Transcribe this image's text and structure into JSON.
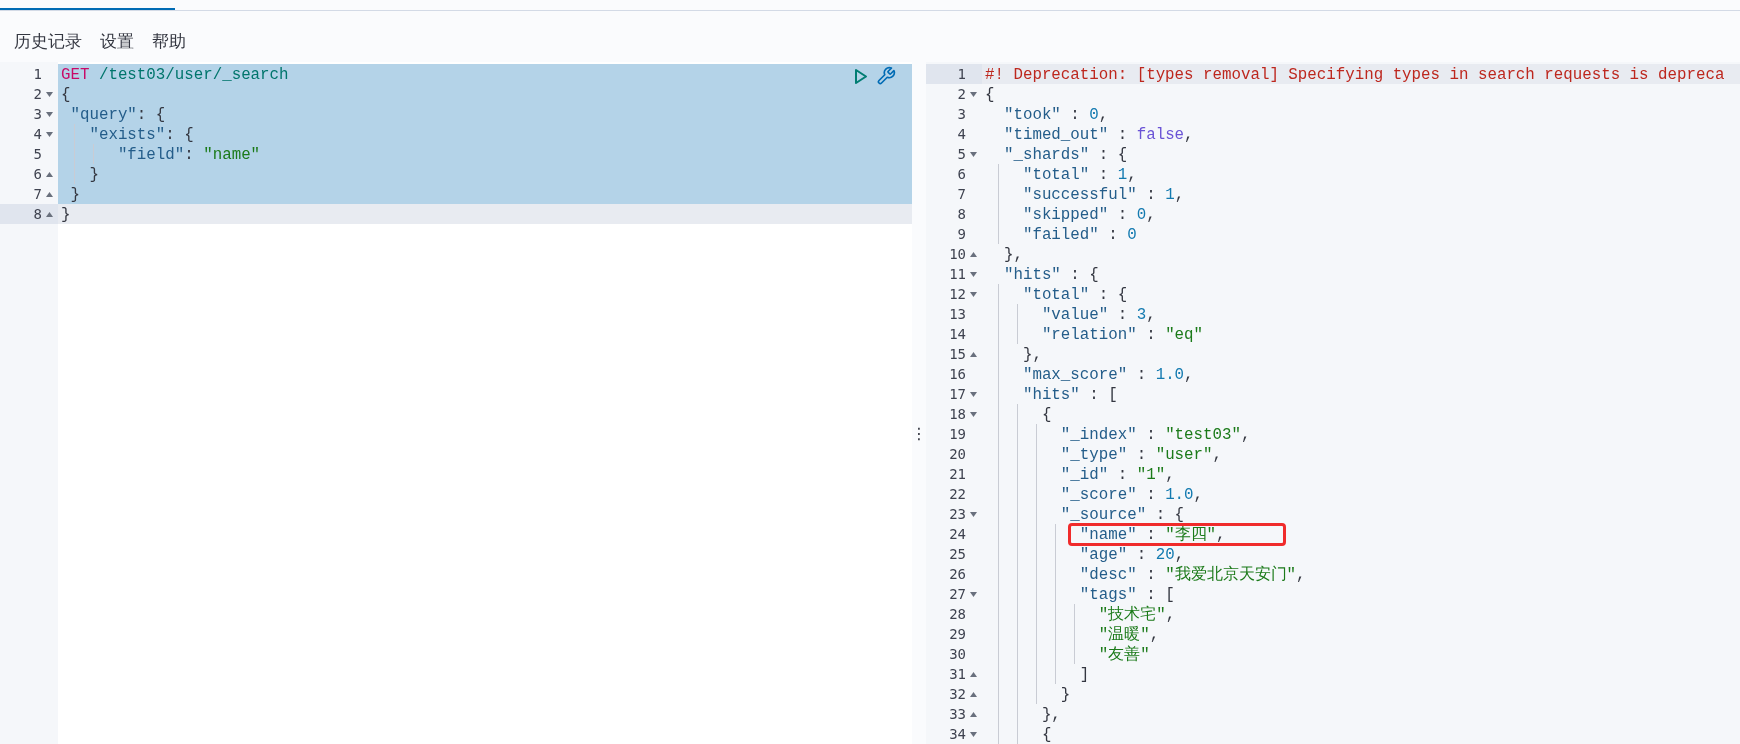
{
  "menu": [
    "历史记录",
    "设置",
    "帮助"
  ],
  "request_editor": {
    "lines": [
      {
        "n": "1",
        "kind": "plain",
        "selected": true,
        "active": false,
        "tokens": [
          {
            "kind": "method",
            "text": "GET"
          },
          {
            "kind": "url",
            "text": " /test03/user/_search"
          }
        ]
      },
      {
        "n": "2",
        "kind": "open",
        "selected": true,
        "active": false,
        "tokens": [
          {
            "kind": "punct",
            "text": "{"
          }
        ]
      },
      {
        "n": "3",
        "kind": "open",
        "selected": true,
        "active": false,
        "tokens": [
          {
            "kind": "key",
            "text": " \"query\""
          },
          {
            "kind": "punct",
            "text": ": {"
          }
        ]
      },
      {
        "n": "4",
        "kind": "open",
        "selected": true,
        "active": false,
        "tokens": [
          {
            "kind": "key",
            "text": "   \"exists\""
          },
          {
            "kind": "punct",
            "text": ": {"
          }
        ]
      },
      {
        "n": "5",
        "kind": "plain",
        "selected": true,
        "active": false,
        "tokens": [
          {
            "kind": "key",
            "text": "      \"field\""
          },
          {
            "kind": "punct",
            "text": ": "
          },
          {
            "kind": "string",
            "text": "\"name\""
          }
        ]
      },
      {
        "n": "6",
        "kind": "close",
        "selected": true,
        "active": false,
        "tokens": [
          {
            "kind": "punct",
            "text": "   }"
          }
        ]
      },
      {
        "n": "7",
        "kind": "close",
        "selected": true,
        "active": false,
        "tokens": [
          {
            "kind": "punct",
            "text": " }"
          }
        ]
      },
      {
        "n": "8",
        "kind": "close",
        "selected": false,
        "active": true,
        "tokens": [
          {
            "kind": "punct",
            "text": "}"
          }
        ]
      }
    ]
  },
  "response_editor": {
    "lines": [
      {
        "n": "1",
        "kind": "plain",
        "active": true,
        "boxed": false,
        "tokens": [
          {
            "kind": "comment",
            "text": "#! Deprecation: [types removal] Specifying types in search requests is depreca"
          }
        ]
      },
      {
        "n": "2",
        "kind": "open",
        "active": false,
        "boxed": false,
        "tokens": [
          {
            "kind": "punct",
            "text": "{"
          }
        ]
      },
      {
        "n": "3",
        "kind": "plain",
        "active": false,
        "boxed": false,
        "tokens": [
          {
            "kind": "key",
            "text": "  \"took\""
          },
          {
            "kind": "punct",
            "text": " : "
          },
          {
            "kind": "number",
            "text": "0"
          },
          {
            "kind": "punct",
            "text": ","
          }
        ]
      },
      {
        "n": "4",
        "kind": "plain",
        "active": false,
        "boxed": false,
        "tokens": [
          {
            "kind": "key",
            "text": "  \"timed_out\""
          },
          {
            "kind": "punct",
            "text": " : "
          },
          {
            "kind": "bool",
            "text": "false"
          },
          {
            "kind": "punct",
            "text": ","
          }
        ]
      },
      {
        "n": "5",
        "kind": "open",
        "active": false,
        "boxed": false,
        "tokens": [
          {
            "kind": "key",
            "text": "  \"_shards\""
          },
          {
            "kind": "punct",
            "text": " : {"
          }
        ]
      },
      {
        "n": "6",
        "kind": "plain",
        "active": false,
        "boxed": false,
        "tokens": [
          {
            "kind": "key",
            "text": "    \"total\""
          },
          {
            "kind": "punct",
            "text": " : "
          },
          {
            "kind": "number",
            "text": "1"
          },
          {
            "kind": "punct",
            "text": ","
          }
        ]
      },
      {
        "n": "7",
        "kind": "plain",
        "active": false,
        "boxed": false,
        "tokens": [
          {
            "kind": "key",
            "text": "    \"successful\""
          },
          {
            "kind": "punct",
            "text": " : "
          },
          {
            "kind": "number",
            "text": "1"
          },
          {
            "kind": "punct",
            "text": ","
          }
        ]
      },
      {
        "n": "8",
        "kind": "plain",
        "active": false,
        "boxed": false,
        "tokens": [
          {
            "kind": "key",
            "text": "    \"skipped\""
          },
          {
            "kind": "punct",
            "text": " : "
          },
          {
            "kind": "number",
            "text": "0"
          },
          {
            "kind": "punct",
            "text": ","
          }
        ]
      },
      {
        "n": "9",
        "kind": "plain",
        "active": false,
        "boxed": false,
        "tokens": [
          {
            "kind": "key",
            "text": "    \"failed\""
          },
          {
            "kind": "punct",
            "text": " : "
          },
          {
            "kind": "number",
            "text": "0"
          }
        ]
      },
      {
        "n": "10",
        "kind": "close",
        "active": false,
        "boxed": false,
        "tokens": [
          {
            "kind": "punct",
            "text": "  },"
          }
        ]
      },
      {
        "n": "11",
        "kind": "open",
        "active": false,
        "boxed": false,
        "tokens": [
          {
            "kind": "key",
            "text": "  \"hits\""
          },
          {
            "kind": "punct",
            "text": " : {"
          }
        ]
      },
      {
        "n": "12",
        "kind": "open",
        "active": false,
        "boxed": false,
        "tokens": [
          {
            "kind": "key",
            "text": "    \"total\""
          },
          {
            "kind": "punct",
            "text": " : {"
          }
        ]
      },
      {
        "n": "13",
        "kind": "plain",
        "active": false,
        "boxed": false,
        "tokens": [
          {
            "kind": "key",
            "text": "      \"value\""
          },
          {
            "kind": "punct",
            "text": " : "
          },
          {
            "kind": "number",
            "text": "3"
          },
          {
            "kind": "punct",
            "text": ","
          }
        ]
      },
      {
        "n": "14",
        "kind": "plain",
        "active": false,
        "boxed": false,
        "tokens": [
          {
            "kind": "key",
            "text": "      \"relation\""
          },
          {
            "kind": "punct",
            "text": " : "
          },
          {
            "kind": "string",
            "text": "\"eq\""
          }
        ]
      },
      {
        "n": "15",
        "kind": "close",
        "active": false,
        "boxed": false,
        "tokens": [
          {
            "kind": "punct",
            "text": "    },"
          }
        ]
      },
      {
        "n": "16",
        "kind": "plain",
        "active": false,
        "boxed": false,
        "tokens": [
          {
            "kind": "key",
            "text": "    \"max_score\""
          },
          {
            "kind": "punct",
            "text": " : "
          },
          {
            "kind": "number",
            "text": "1.0"
          },
          {
            "kind": "punct",
            "text": ","
          }
        ]
      },
      {
        "n": "17",
        "kind": "open",
        "active": false,
        "boxed": false,
        "tokens": [
          {
            "kind": "key",
            "text": "    \"hits\""
          },
          {
            "kind": "punct",
            "text": " : ["
          }
        ]
      },
      {
        "n": "18",
        "kind": "open",
        "active": false,
        "boxed": false,
        "tokens": [
          {
            "kind": "punct",
            "text": "      {"
          }
        ]
      },
      {
        "n": "19",
        "kind": "plain",
        "active": false,
        "boxed": false,
        "tokens": [
          {
            "kind": "key",
            "text": "        \"_index\""
          },
          {
            "kind": "punct",
            "text": " : "
          },
          {
            "kind": "string",
            "text": "\"test03\""
          },
          {
            "kind": "punct",
            "text": ","
          }
        ]
      },
      {
        "n": "20",
        "kind": "plain",
        "active": false,
        "boxed": false,
        "tokens": [
          {
            "kind": "key",
            "text": "        \"_type\""
          },
          {
            "kind": "punct",
            "text": " : "
          },
          {
            "kind": "string",
            "text": "\"user\""
          },
          {
            "kind": "punct",
            "text": ","
          }
        ]
      },
      {
        "n": "21",
        "kind": "plain",
        "active": false,
        "boxed": false,
        "tokens": [
          {
            "kind": "key",
            "text": "        \"_id\""
          },
          {
            "kind": "punct",
            "text": " : "
          },
          {
            "kind": "string",
            "text": "\"1\""
          },
          {
            "kind": "punct",
            "text": ","
          }
        ]
      },
      {
        "n": "22",
        "kind": "plain",
        "active": false,
        "boxed": false,
        "tokens": [
          {
            "kind": "key",
            "text": "        \"_score\""
          },
          {
            "kind": "punct",
            "text": " : "
          },
          {
            "kind": "number",
            "text": "1.0"
          },
          {
            "kind": "punct",
            "text": ","
          }
        ]
      },
      {
        "n": "23",
        "kind": "open",
        "active": false,
        "boxed": false,
        "tokens": [
          {
            "kind": "key",
            "text": "        \"_source\""
          },
          {
            "kind": "punct",
            "text": " : {"
          }
        ]
      },
      {
        "n": "24",
        "kind": "plain",
        "active": false,
        "boxed": true,
        "tokens": [
          {
            "kind": "key",
            "text": "          \"name\""
          },
          {
            "kind": "punct",
            "text": " : "
          },
          {
            "kind": "string",
            "text": "\"李四\""
          },
          {
            "kind": "punct",
            "text": ","
          }
        ]
      },
      {
        "n": "25",
        "kind": "plain",
        "active": false,
        "boxed": false,
        "tokens": [
          {
            "kind": "key",
            "text": "          \"age\""
          },
          {
            "kind": "punct",
            "text": " : "
          },
          {
            "kind": "number",
            "text": "20"
          },
          {
            "kind": "punct",
            "text": ","
          }
        ]
      },
      {
        "n": "26",
        "kind": "plain",
        "active": false,
        "boxed": false,
        "tokens": [
          {
            "kind": "key",
            "text": "          \"desc\""
          },
          {
            "kind": "punct",
            "text": " : "
          },
          {
            "kind": "string",
            "text": "\"我爱北京天安门\""
          },
          {
            "kind": "punct",
            "text": ","
          }
        ]
      },
      {
        "n": "27",
        "kind": "open",
        "active": false,
        "boxed": false,
        "tokens": [
          {
            "kind": "key",
            "text": "          \"tags\""
          },
          {
            "kind": "punct",
            "text": " : ["
          }
        ]
      },
      {
        "n": "28",
        "kind": "plain",
        "active": false,
        "boxed": false,
        "tokens": [
          {
            "kind": "string",
            "text": "            \"技术宅\""
          },
          {
            "kind": "punct",
            "text": ","
          }
        ]
      },
      {
        "n": "29",
        "kind": "plain",
        "active": false,
        "boxed": false,
        "tokens": [
          {
            "kind": "string",
            "text": "            \"温暖\""
          },
          {
            "kind": "punct",
            "text": ","
          }
        ]
      },
      {
        "n": "30",
        "kind": "plain",
        "active": false,
        "boxed": false,
        "tokens": [
          {
            "kind": "string",
            "text": "            \"友善\""
          }
        ]
      },
      {
        "n": "31",
        "kind": "close",
        "active": false,
        "boxed": false,
        "tokens": [
          {
            "kind": "punct",
            "text": "          ]"
          }
        ]
      },
      {
        "n": "32",
        "kind": "close",
        "active": false,
        "boxed": false,
        "tokens": [
          {
            "kind": "punct",
            "text": "        }"
          }
        ]
      },
      {
        "n": "33",
        "kind": "close",
        "active": false,
        "boxed": false,
        "tokens": [
          {
            "kind": "punct",
            "text": "      },"
          }
        ]
      },
      {
        "n": "34",
        "kind": "open",
        "active": false,
        "boxed": false,
        "tokens": [
          {
            "kind": "punct",
            "text": "      {"
          }
        ]
      }
    ]
  },
  "splitter": "⋮"
}
